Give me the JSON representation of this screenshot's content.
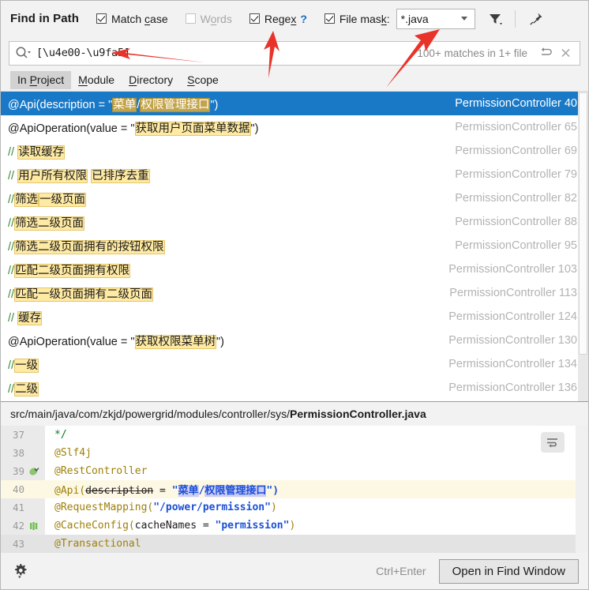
{
  "window": {
    "title": "Find in Path"
  },
  "options": {
    "match_case": {
      "label": "Match case",
      "checked": true,
      "enabled": true
    },
    "words": {
      "label": "Words",
      "checked": false,
      "enabled": false
    },
    "regex": {
      "label": "Regex",
      "checked": true,
      "enabled": true,
      "help": "?"
    },
    "file_mask": {
      "label": "File mask:",
      "checked": true,
      "value": "*.java"
    },
    "filter_icon": "filter-icon",
    "pin_icon": "pin-icon"
  },
  "search": {
    "query": "[\\u4e00-\\u9fa5]",
    "placeholder": "",
    "match_info": "100+ matches in 1+ file",
    "search_icon": "search-icon",
    "rerun_icon": "rerun-icon",
    "close_icon": "close-icon"
  },
  "scope_tabs": [
    {
      "label": "In Project",
      "active": true
    },
    {
      "label": "Module",
      "active": false
    },
    {
      "label": "Directory",
      "active": false
    },
    {
      "label": "Scope",
      "active": false
    }
  ],
  "results": [
    {
      "selected": true,
      "prefix": "@Api(description = \"",
      "matches": [
        "菜单",
        "权限管理接口"
      ],
      "separator": "/",
      "suffix": "\")",
      "comment": false,
      "file": "PermissionController",
      "line": "40"
    },
    {
      "selected": false,
      "prefix": "@ApiOperation(value = \"",
      "matches": [
        "获取用户页面菜单数据"
      ],
      "separator": "",
      "suffix": "\")",
      "comment": false,
      "file": "PermissionController",
      "line": "65"
    },
    {
      "selected": false,
      "prefix": "// ",
      "matches": [
        "读取缓存"
      ],
      "separator": "",
      "suffix": "",
      "comment": true,
      "file": "PermissionController",
      "line": "69"
    },
    {
      "selected": false,
      "prefix": "// ",
      "matches": [
        "用户所有权限",
        "已排序去重"
      ],
      "separator": " ",
      "suffix": "",
      "comment": true,
      "file": "PermissionController",
      "line": "79"
    },
    {
      "selected": false,
      "prefix": "//",
      "matches": [
        "筛选",
        "一级页面"
      ],
      "separator": "",
      "suffix": "",
      "comment": true,
      "file": "PermissionController",
      "line": "82"
    },
    {
      "selected": false,
      "prefix": "//",
      "matches": [
        "筛选二级页面"
      ],
      "separator": "",
      "suffix": "",
      "comment": true,
      "file": "PermissionController",
      "line": "88"
    },
    {
      "selected": false,
      "prefix": "//",
      "matches": [
        "筛选二级页面拥有的按钮权限"
      ],
      "separator": "",
      "suffix": "",
      "comment": true,
      "file": "PermissionController",
      "line": "95"
    },
    {
      "selected": false,
      "prefix": "//",
      "matches": [
        "匹配二级页面拥有权限"
      ],
      "separator": "",
      "suffix": "",
      "comment": true,
      "file": "PermissionController",
      "line": "103"
    },
    {
      "selected": false,
      "prefix": "//",
      "matches": [
        "匹配一级页面拥有二级页面"
      ],
      "separator": "",
      "suffix": "",
      "comment": true,
      "file": "PermissionController",
      "line": "113"
    },
    {
      "selected": false,
      "prefix": "// ",
      "matches": [
        "缓存"
      ],
      "separator": "",
      "suffix": "",
      "comment": true,
      "file": "PermissionController",
      "line": "124"
    },
    {
      "selected": false,
      "prefix": "@ApiOperation(value = \"",
      "matches": [
        "获取权限菜单树"
      ],
      "separator": "",
      "suffix": "\")",
      "comment": false,
      "file": "PermissionController",
      "line": "130"
    },
    {
      "selected": false,
      "prefix": "//",
      "matches": [
        "一级"
      ],
      "separator": "",
      "suffix": "",
      "comment": true,
      "file": "PermissionController",
      "line": "134"
    },
    {
      "selected": false,
      "prefix": "//",
      "matches": [
        "二级"
      ],
      "separator": "",
      "suffix": "",
      "comment": true,
      "file": "PermissionController",
      "line": "136"
    }
  ],
  "preview": {
    "path_prefix": "src/main/java/com/zkjd/powergrid/modules/controller/sys/",
    "file_name": "PermissionController.java",
    "wrap_icon": "soft-wrap-icon",
    "lines": [
      {
        "num": "37",
        "gutter_icon": "",
        "highlight": false,
        "segments": [
          {
            "t": "  */",
            "c": "str"
          }
        ]
      },
      {
        "num": "38",
        "gutter_icon": "",
        "highlight": false,
        "segments": [
          {
            "t": "@Slf4j",
            "c": "ann"
          }
        ]
      },
      {
        "num": "39",
        "gutter_icon": "spring-bean-icon",
        "highlight": false,
        "segments": [
          {
            "t": "@RestController",
            "c": "ann"
          }
        ]
      },
      {
        "num": "40",
        "gutter_icon": "",
        "highlight": true,
        "segments": [
          {
            "t": "@Api(",
            "c": "ann"
          },
          {
            "t": "description",
            "c": "strike"
          },
          {
            "t": " = ",
            "c": "kw"
          },
          {
            "t": "\"",
            "c": "strb"
          },
          {
            "t": "菜单",
            "c": "match"
          },
          {
            "t": "/",
            "c": "strb"
          },
          {
            "t": "权限管理接口",
            "c": "match"
          },
          {
            "t": "\")",
            "c": "strb"
          }
        ]
      },
      {
        "num": "41",
        "gutter_icon": "",
        "highlight": false,
        "segments": [
          {
            "t": "@RequestMapping(",
            "c": "ann"
          },
          {
            "t": "\"/power/permission\"",
            "c": "strb"
          },
          {
            "t": ")",
            "c": "ann"
          }
        ]
      },
      {
        "num": "42",
        "gutter_icon": "cache-icon",
        "highlight": false,
        "segments": [
          {
            "t": "@CacheConfig(",
            "c": "ann"
          },
          {
            "t": "cacheNames",
            "c": "kw"
          },
          {
            "t": " = ",
            "c": "kw"
          },
          {
            "t": "\"permission\"",
            "c": "strb"
          },
          {
            "t": ")",
            "c": "ann"
          }
        ]
      },
      {
        "num": "43",
        "gutter_icon": "",
        "highlight": false,
        "clipped": true,
        "segments": [
          {
            "t": "@Transactional",
            "c": "ann"
          }
        ]
      }
    ]
  },
  "bottom": {
    "settings_icon": "gear-icon",
    "shortcut": "Ctrl+Enter",
    "open_button": "Open in Find Window"
  },
  "colors": {
    "selection_blue": "#1a79c7",
    "match_yellow": "#ffeaa3",
    "code_match_purple": "#ccccf5",
    "annotation_red": "#e8332a",
    "link_blue": "#1668c1"
  }
}
